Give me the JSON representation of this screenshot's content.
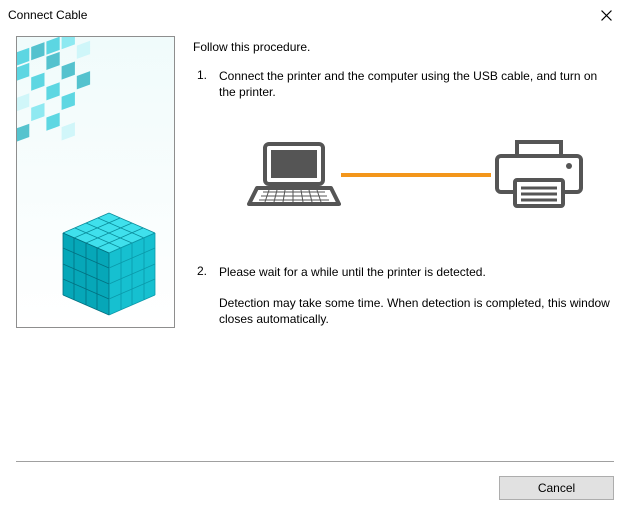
{
  "window": {
    "title": "Connect Cable"
  },
  "intro": "Follow this procedure.",
  "steps": [
    {
      "num": "1.",
      "text": "Connect the printer and the computer using the USB cable, and turn on the printer."
    },
    {
      "num": "2.",
      "text": "Please wait for a while until the printer is detected.",
      "note": "Detection may take some time. When detection is completed, this window closes automatically."
    }
  ],
  "buttons": {
    "cancel": "Cancel"
  },
  "icons": {
    "close": "close-icon",
    "laptop": "laptop-icon",
    "printer": "printer-icon",
    "cable": "usb-cable"
  }
}
